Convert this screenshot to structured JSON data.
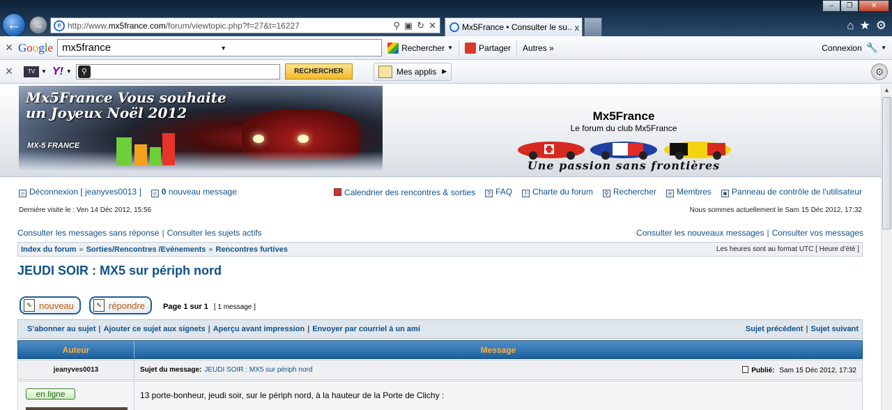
{
  "browser": {
    "url_prefix": "http://www.",
    "url_domain": "mx5france.com",
    "url_suffix": "/forum/viewtopic.php?f=27&t=16227",
    "tab_title": "Mx5France • Consulter le su...",
    "tab_close": "x"
  },
  "google_toolbar": {
    "query": "mx5france",
    "search_label": "Rechercher",
    "share_label": "Partager",
    "more_label": "Autres »",
    "connect_label": "Connexion"
  },
  "yahoo_toolbar": {
    "search_button": "RECHERCHER",
    "apps_label": "Mes applis"
  },
  "header": {
    "banner_line1": "Mx5France Vous souhaite",
    "banner_line2": "un Joyeux Noël 2012",
    "banner_logo": "MX-5 FRANCE",
    "site_title": "Mx5France",
    "site_desc": "Le forum du club Mx5France",
    "slogan": "Une passion sans frontières"
  },
  "nav": {
    "logout": "Déconnexion [ jeanyves0013 ]",
    "new_msg_count": "0",
    "new_msg_label": "nouveau message",
    "calendar": "Calendrier des rencontres & sorties",
    "faq": "FAQ",
    "charter": "Charte du forum",
    "search": "Rechercher",
    "members": "Membres",
    "control_panel": "Panneau de contrôle de l'utilisateur",
    "last_visit": "Dernière visite le : Ven 14 Déc 2012, 15:56",
    "current_time": "Nous sommes actuellement le Sam 15 Déc 2012, 17:32",
    "unanswered": "Consulter les messages sans réponse",
    "active": "Consulter les sujets actifs",
    "new_posts": "Consulter les nouveaux messages",
    "your_posts": "Consulter vos messages"
  },
  "breadcrumb": {
    "items": [
      "Index du forum",
      "Sorties/Rencontres /Evénements",
      "Rencontres furtives"
    ],
    "sep": "»",
    "timezone": "Les heures sont au format UTC [ Heure d’été ]"
  },
  "topic": {
    "title": "JEUDI SOIR : MX5 sur périph nord",
    "new_button": "nouveau",
    "reply_button": "répondre",
    "page_info": "Page 1 sur 1",
    "msg_count": "[ 1 message ]",
    "subscribe": "S’abonner au sujet",
    "bookmark": "Ajouter ce sujet aux signets",
    "print": "Aperçu avant impression",
    "email": "Envoyer par courriel à un ami",
    "prev": "Sujet précédent",
    "next": "Sujet suivant"
  },
  "table": {
    "col_author": "Auteur",
    "col_message": "Message"
  },
  "post": {
    "author": "jeanyves0013",
    "subject_label": "Sujet du message:",
    "subject": "JEUDI SOIR : MX5 sur périph nord",
    "posted_label": "Publié:",
    "posted_date": "Sam 15 Déc 2012, 17:32",
    "online": "en ligne",
    "body": "13 porte-bonheur, jeudi soir, sur le périph nord, à la hauteur de la Porte de Clichy :"
  }
}
